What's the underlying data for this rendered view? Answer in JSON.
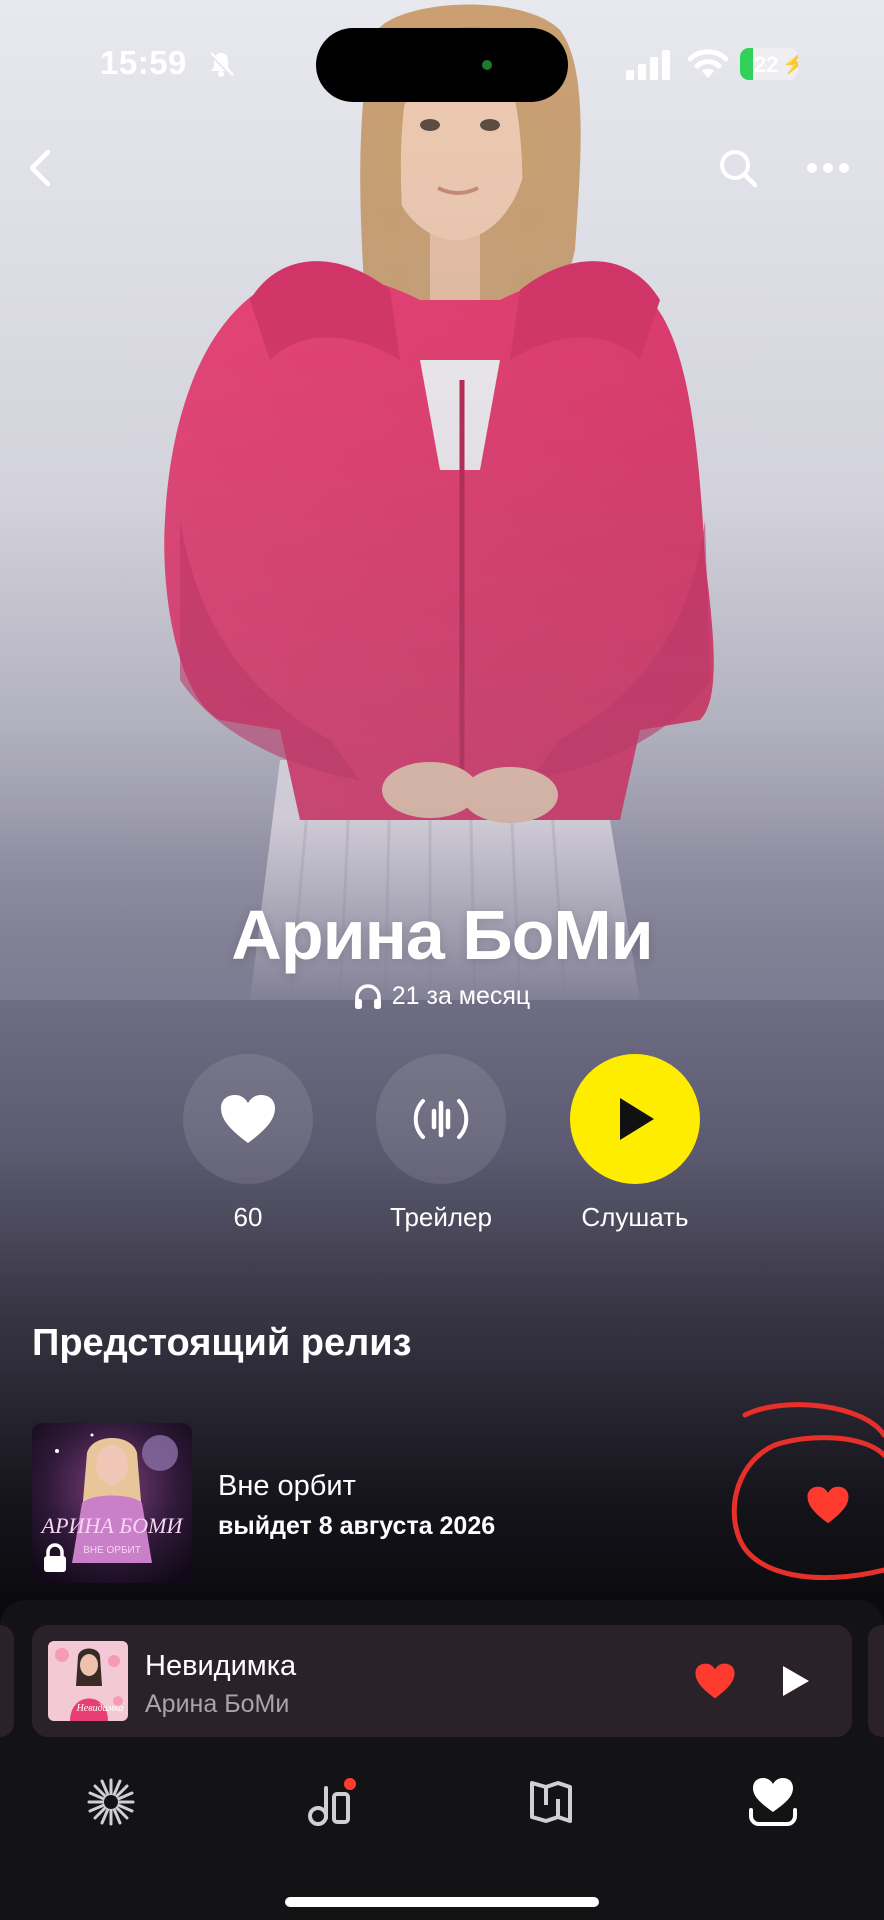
{
  "status_bar": {
    "time": "15:59",
    "battery": "22"
  },
  "artist": {
    "name": "Арина БоМи",
    "listeners": "21 за месяц"
  },
  "actions": {
    "like_count": "60",
    "trailer_label": "Трейлер",
    "listen_label": "Слушать"
  },
  "upcoming": {
    "section_title": "Предстоящий релиз",
    "title": "Вне орбит",
    "release_date": "выйдет 8 августа 2026",
    "cover_text_top": "АРИНА БОМИ",
    "cover_text_bottom": "ВНЕ ОРБИТ"
  },
  "now_playing": {
    "title": "Невидимка",
    "artist": "Арина БоМи",
    "cover_text": "Невидимка"
  },
  "colors": {
    "accent_yellow": "#ffed00",
    "heart_red": "#ff3b30",
    "annotation_red": "#e8302a"
  },
  "icons": {
    "back": "chevron-left-icon",
    "search": "search-icon",
    "more": "ellipsis-icon",
    "listeners": "headphones-icon",
    "tabs": [
      "sparkle-icon",
      "music-library-icon",
      "book-map-icon",
      "heart-collection-icon"
    ]
  }
}
